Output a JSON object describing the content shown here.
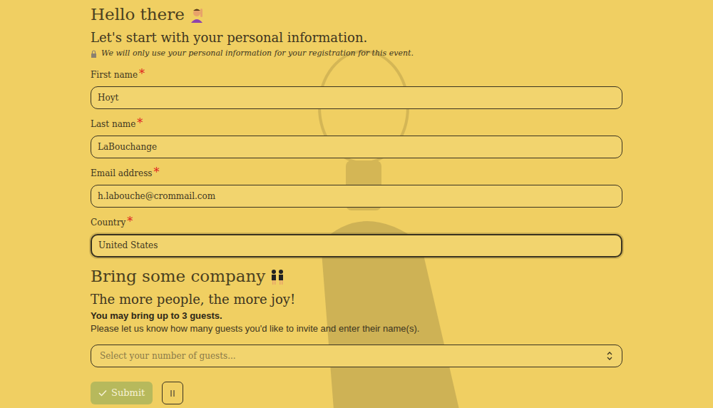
{
  "greeting": {
    "title": "Hello there",
    "subtitle": "Let's start with your personal information.",
    "note": "We will only use your personal information for your registration for this event."
  },
  "fields": [
    {
      "label": "First name",
      "required_mark": "*",
      "value": "Hoyt",
      "focused": false
    },
    {
      "label": "Last name",
      "required_mark": "*",
      "value": "LaBouchange",
      "focused": false
    },
    {
      "label": "Email address",
      "required_mark": "*",
      "value": "h.labouche@crommail.com",
      "focused": false
    },
    {
      "label": "Country",
      "required_mark": "*",
      "value": "United States",
      "focused": true
    }
  ],
  "guests": {
    "title": "Bring some company",
    "subtitle": "The more people, the more joy!",
    "limit": "You may bring up to 3 guests.",
    "instructions": "Please let us know how many guests you'd like to invite and enter their name(s).",
    "select_placeholder": "Select your number of guests..."
  },
  "buttons": {
    "submit": "Submit"
  }
}
